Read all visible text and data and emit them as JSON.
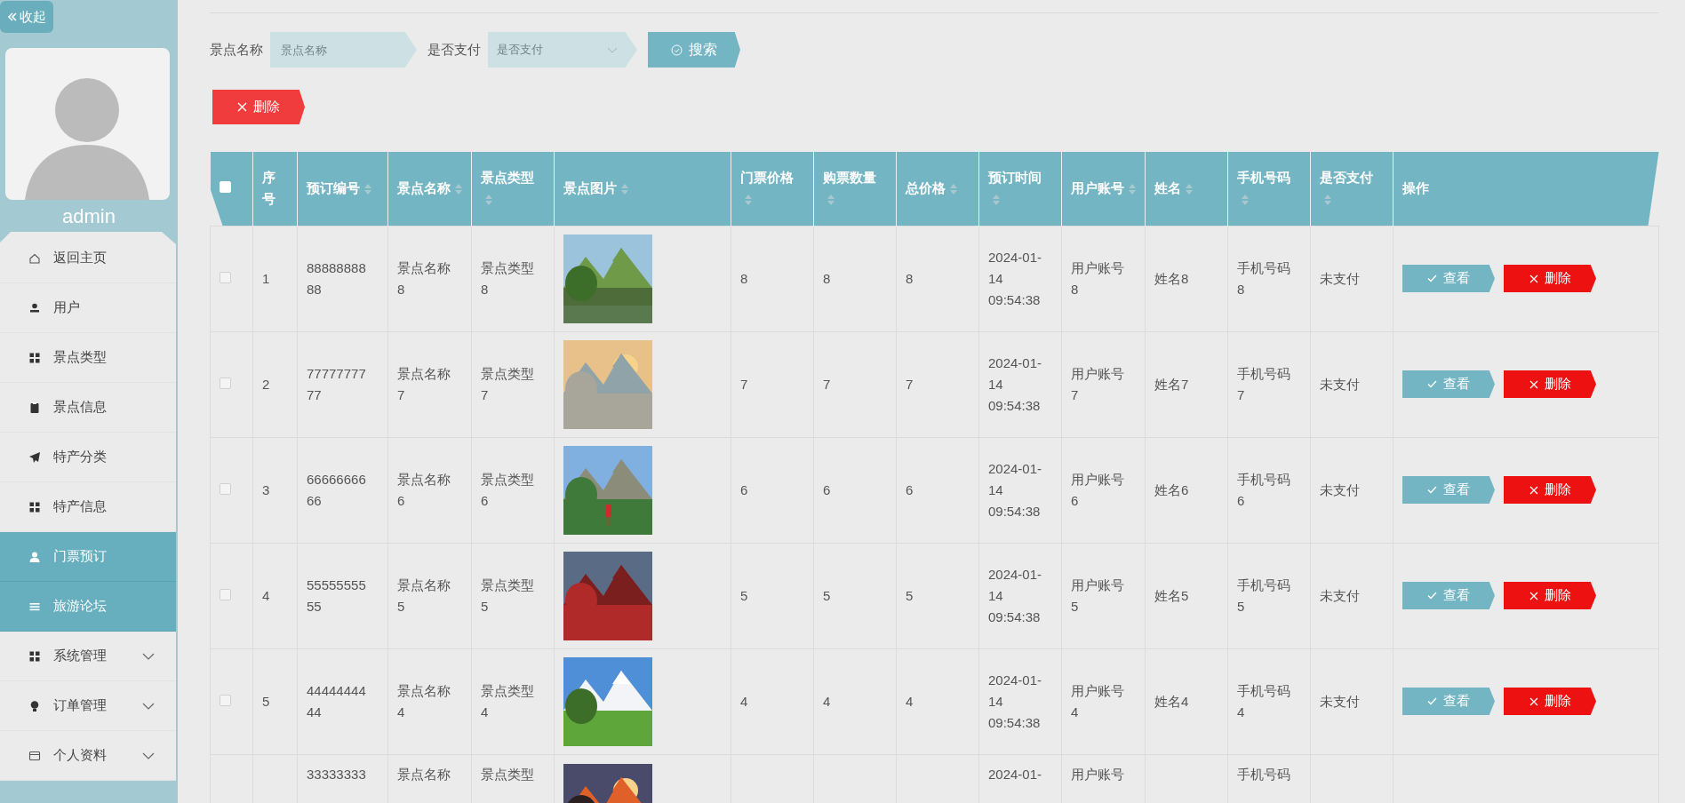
{
  "sidebar": {
    "collapse_button": "收起",
    "username": "admin",
    "menu": [
      {
        "label": "返回主页",
        "selected": false,
        "has_submenu": false
      },
      {
        "label": "用户",
        "selected": false,
        "has_submenu": false
      },
      {
        "label": "景点类型",
        "selected": false,
        "has_submenu": false
      },
      {
        "label": "景点信息",
        "selected": false,
        "has_submenu": false
      },
      {
        "label": "特产分类",
        "selected": false,
        "has_submenu": false
      },
      {
        "label": "特产信息",
        "selected": false,
        "has_submenu": false
      },
      {
        "label": "门票预订",
        "selected": true,
        "has_submenu": false
      },
      {
        "label": "旅游论坛",
        "selected": true,
        "has_submenu": false
      },
      {
        "label": "系统管理",
        "selected": false,
        "has_submenu": true
      },
      {
        "label": "订单管理",
        "selected": false,
        "has_submenu": true
      },
      {
        "label": "个人资料",
        "selected": false,
        "has_submenu": true
      }
    ]
  },
  "search": {
    "name_label": "景点名称",
    "name_placeholder": "景点名称",
    "paid_label": "是否支付",
    "paid_placeholder": "是否支付",
    "search_button": "搜索"
  },
  "delete_button": "删除",
  "table": {
    "select_all": {
      "checked": false
    },
    "columns": [
      {
        "label": "序号",
        "sortable": false
      },
      {
        "label": "预订编号",
        "sortable": true
      },
      {
        "label": "景点名称",
        "sortable": true
      },
      {
        "label": "景点类型",
        "sortable": true
      },
      {
        "label": "景点图片",
        "sortable": true
      },
      {
        "label": "门票价格",
        "sortable": true
      },
      {
        "label": "购票数量",
        "sortable": true
      },
      {
        "label": "总价格",
        "sortable": true
      },
      {
        "label": "预订时间",
        "sortable": true
      },
      {
        "label": "用户账号",
        "sortable": true
      },
      {
        "label": "姓名",
        "sortable": true
      },
      {
        "label": "手机号码",
        "sortable": true
      },
      {
        "label": "是否支付",
        "sortable": true
      },
      {
        "label": "操作",
        "sortable": false
      }
    ],
    "rows": [
      {
        "checked": false,
        "no": "1",
        "order_no": "8888888888",
        "name": "景点名称8",
        "type": "景点类型8",
        "price": "8",
        "qty": "8",
        "total": "8",
        "time": "2024-01-14 09:54:38",
        "account": "用户账号8",
        "person": "姓名8",
        "phone": "手机号码8",
        "paid": "未支付",
        "actions": [
          "查看",
          "删除"
        ]
      },
      {
        "checked": false,
        "no": "2",
        "order_no": "7777777777",
        "name": "景点名称7",
        "type": "景点类型7",
        "price": "7",
        "qty": "7",
        "total": "7",
        "time": "2024-01-14 09:54:38",
        "account": "用户账号7",
        "person": "姓名7",
        "phone": "手机号码7",
        "paid": "未支付",
        "actions": [
          "查看",
          "删除"
        ]
      },
      {
        "checked": false,
        "no": "3",
        "order_no": "6666666666",
        "name": "景点名称6",
        "type": "景点类型6",
        "price": "6",
        "qty": "6",
        "total": "6",
        "time": "2024-01-14 09:54:38",
        "account": "用户账号6",
        "person": "姓名6",
        "phone": "手机号码6",
        "paid": "未支付",
        "actions": [
          "查看",
          "删除"
        ]
      },
      {
        "checked": false,
        "no": "4",
        "order_no": "5555555555",
        "name": "景点名称5",
        "type": "景点类型5",
        "price": "5",
        "qty": "5",
        "total": "5",
        "time": "2024-01-14 09:54:38",
        "account": "用户账号5",
        "person": "姓名5",
        "phone": "手机号码5",
        "paid": "未支付",
        "actions": [
          "查看",
          "删除"
        ]
      },
      {
        "checked": false,
        "no": "5",
        "order_no": "4444444444",
        "name": "景点名称4",
        "type": "景点类型4",
        "price": "4",
        "qty": "4",
        "total": "4",
        "time": "2024-01-14 09:54:38",
        "account": "用户账号4",
        "person": "姓名4",
        "phone": "手机号码4",
        "paid": "未支付",
        "actions": [
          "查看",
          "删除"
        ]
      },
      {
        "order_no": "33333333",
        "name": "景点名称",
        "type": "景点类型",
        "time": "2024-01-",
        "account": "用户账号",
        "phone": "手机号码"
      }
    ]
  }
}
